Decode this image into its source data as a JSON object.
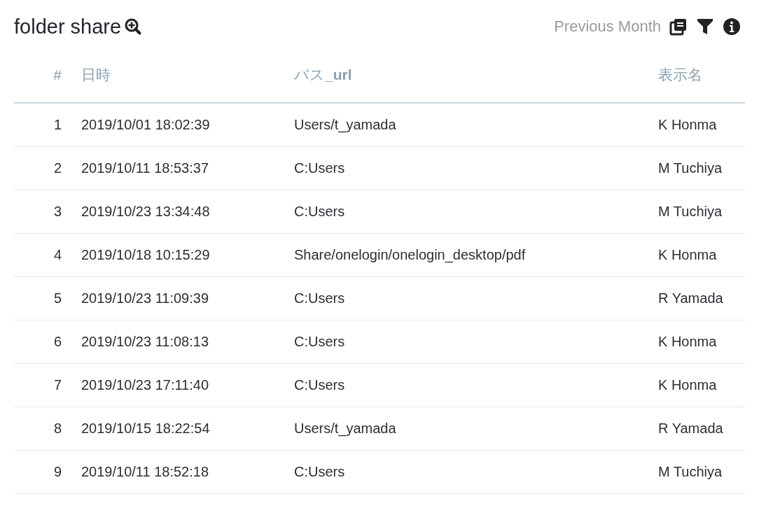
{
  "title": "folder share",
  "period": "Previous Month",
  "table": {
    "columns": [
      "#",
      "日時",
      "パス**_url**",
      "表示名"
    ],
    "rows": [
      [
        "1",
        "2019/10/01 18:02:39",
        "Users/t_yamada",
        "K Honma"
      ],
      [
        "2",
        "2019/10/11 18:53:37",
        "C:Users",
        "M Tuchiya"
      ],
      [
        "3",
        "2019/10/23 13:34:48",
        "C:Users",
        "M Tuchiya"
      ],
      [
        "4",
        "2019/10/18 10:15:29",
        "Share/onelogin/onelogin_desktop/pdf",
        "K Honma"
      ],
      [
        "5",
        "2019/10/23 11:09:39",
        "C:Users",
        "R Yamada"
      ],
      [
        "6",
        "2019/10/23 11:08:13",
        "C:Users",
        "K Honma"
      ],
      [
        "7",
        "2019/10/23 17:11:40",
        "C:Users",
        "K Honma"
      ],
      [
        "8",
        "2019/10/15 18:22:54",
        "Users/t_yamada",
        "R Yamada"
      ],
      [
        "9",
        "2019/10/11 18:52:18",
        "C:Users",
        "M Tuchiya"
      ]
    ]
  }
}
